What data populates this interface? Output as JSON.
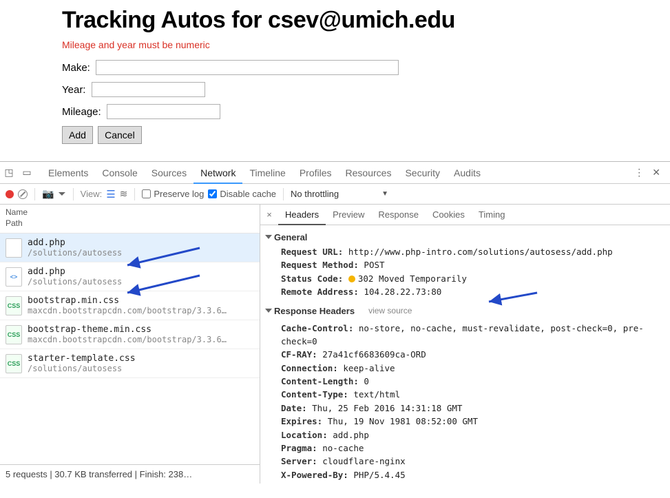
{
  "page": {
    "title": "Tracking Autos for csev@umich.edu",
    "error": "Mileage and year must be numeric",
    "labels": {
      "make": "Make:",
      "year": "Year:",
      "mileage": "Mileage:"
    },
    "buttons": {
      "add": "Add",
      "cancel": "Cancel"
    },
    "values": {
      "make": "",
      "year": "",
      "mileage": ""
    }
  },
  "devtools": {
    "tabs": [
      "Elements",
      "Console",
      "Sources",
      "Network",
      "Timeline",
      "Profiles",
      "Resources",
      "Security",
      "Audits"
    ],
    "active_tab": "Network",
    "toolbar": {
      "view_label": "View:",
      "preserve_log": {
        "label": "Preserve log",
        "checked": false
      },
      "disable_cache": {
        "label": "Disable cache",
        "checked": true
      },
      "throttling": "No throttling"
    },
    "left_header": {
      "name": "Name",
      "path": "Path"
    },
    "requests": [
      {
        "name": "add.php",
        "path": "/solutions/autosess",
        "icon": "doc",
        "selected": true
      },
      {
        "name": "add.php",
        "path": "/solutions/autosess",
        "icon": "code",
        "selected": false
      },
      {
        "name": "bootstrap.min.css",
        "path": "maxcdn.bootstrapcdn.com/bootstrap/3.3.6…",
        "icon": "css",
        "selected": false
      },
      {
        "name": "bootstrap-theme.min.css",
        "path": "maxcdn.bootstrapcdn.com/bootstrap/3.3.6…",
        "icon": "css",
        "selected": false
      },
      {
        "name": "starter-template.css",
        "path": "/solutions/autosess",
        "icon": "css",
        "selected": false
      }
    ],
    "footer": "5 requests  |  30.7 KB transferred  |  Finish: 238…",
    "right_tabs": [
      "Headers",
      "Preview",
      "Response",
      "Cookies",
      "Timing"
    ],
    "right_active": "Headers",
    "general_title": "General",
    "general": [
      {
        "k": "Request URL:",
        "v": "http://www.php-intro.com/solutions/autosess/add.php"
      },
      {
        "k": "Request Method:",
        "v": "POST"
      },
      {
        "k": "Status Code:",
        "v": "302 Moved Temporarily",
        "status": true
      },
      {
        "k": "Remote Address:",
        "v": "104.28.22.73:80"
      }
    ],
    "response_headers_title": "Response Headers",
    "view_source": "view source",
    "response_headers": [
      {
        "k": "Cache-Control:",
        "v": "no-store, no-cache, must-revalidate, post-check=0, pre-check=0",
        "wrap": true
      },
      {
        "k": "CF-RAY:",
        "v": "27a41cf6683609ca-ORD"
      },
      {
        "k": "Connection:",
        "v": "keep-alive"
      },
      {
        "k": "Content-Length:",
        "v": "0"
      },
      {
        "k": "Content-Type:",
        "v": "text/html"
      },
      {
        "k": "Date:",
        "v": "Thu, 25 Feb 2016 14:31:18 GMT"
      },
      {
        "k": "Expires:",
        "v": "Thu, 19 Nov 1981 08:52:00 GMT"
      },
      {
        "k": "Location:",
        "v": "add.php"
      },
      {
        "k": "Pragma:",
        "v": "no-cache"
      },
      {
        "k": "Server:",
        "v": "cloudflare-nginx"
      },
      {
        "k": "X-Powered-By:",
        "v": "PHP/5.4.45"
      }
    ]
  }
}
